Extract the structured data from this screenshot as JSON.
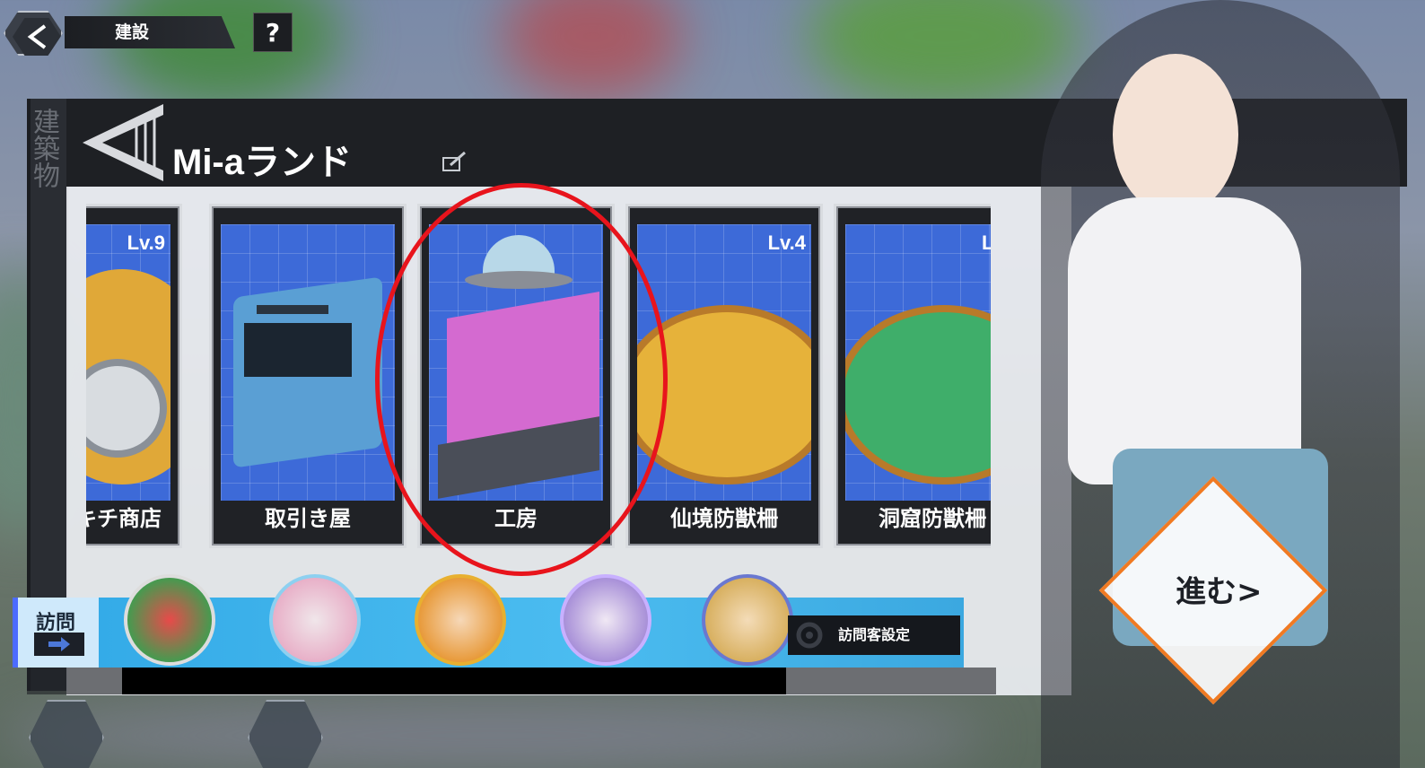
{
  "header": {
    "title": "建設",
    "help_label": "?",
    "side_tab_label": "建築物",
    "land_name": "Mi-aランド"
  },
  "cards": [
    {
      "label": "キチ商店",
      "level": "Lv.9"
    },
    {
      "label": "取引き屋",
      "level": ""
    },
    {
      "label": "工房",
      "level": ""
    },
    {
      "label": "仙境防獣柵",
      "level": "Lv.4"
    },
    {
      "label": "洞窟防獣柵",
      "level": "Lv"
    }
  ],
  "visit": {
    "label": "訪問",
    "settings_label": "訪問客設定"
  },
  "proceed": {
    "label": "進む>"
  },
  "colors": {
    "accent_orange": "#f07a22",
    "highlight_red": "#e8141c",
    "card_blue": "#3d6ad8",
    "visit_bar_blue": "#30a8e6"
  },
  "icons": [
    "back-arrow-icon",
    "help-icon",
    "edit-icon",
    "gear-icon",
    "gift-icon",
    "share-icon"
  ]
}
